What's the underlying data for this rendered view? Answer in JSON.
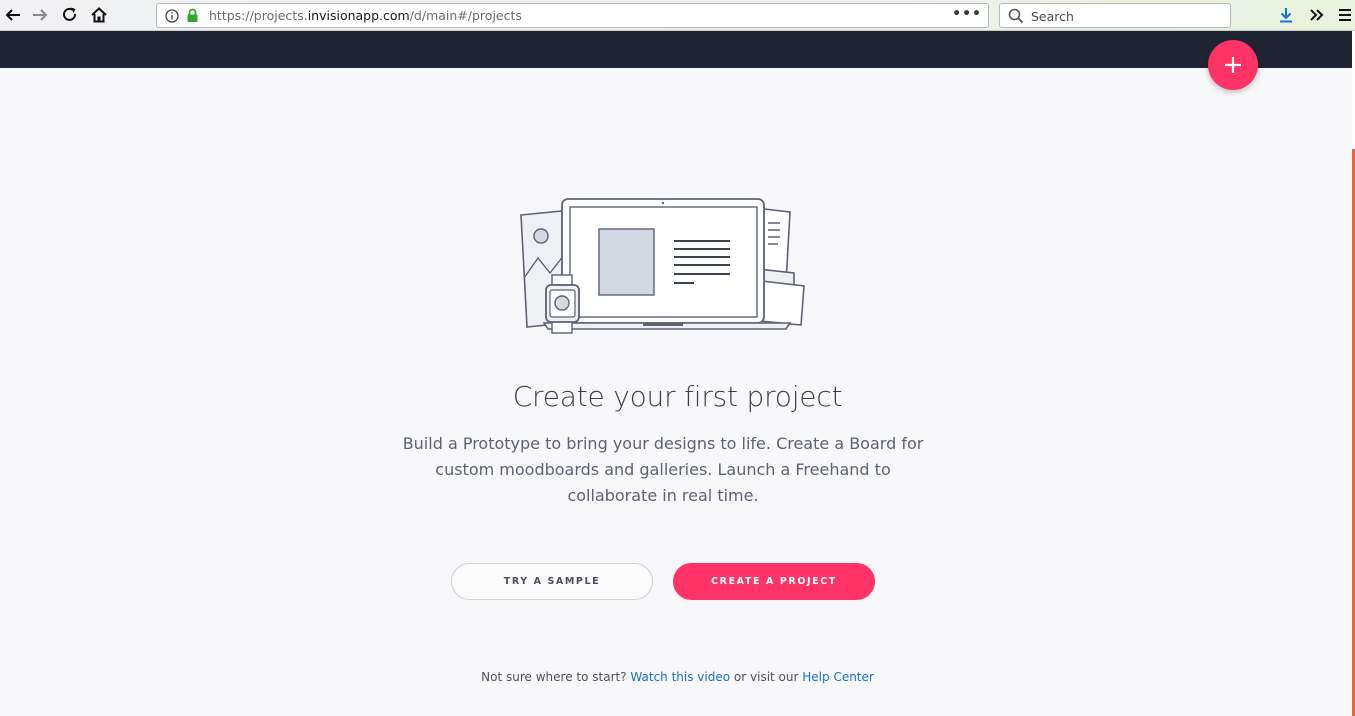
{
  "browser": {
    "url_prefix": "https://projects.",
    "url_host": "invisionapp.com",
    "url_path": "/d/main#/projects",
    "more_label": "•••",
    "search_placeholder": "Search"
  },
  "fab": {
    "icon": "plus-icon"
  },
  "empty_state": {
    "heading": "Create your first project",
    "description": "Build a Prototype to bring your designs to life. Create a Board for custom moodboards and galleries. Launch a Freehand to collaborate in real time.",
    "try_sample_label": "TRY A SAMPLE",
    "create_project_label": "CREATE A PROJECT"
  },
  "help": {
    "prefix": "Not sure where to start?",
    "video_link": "Watch this video",
    "middle": "or visit our",
    "help_link": "Help Center"
  },
  "colors": {
    "accent": "#ff3366",
    "header_bg": "#1f2532",
    "link": "#1a6fd0",
    "page_bg": "#f8f8fa"
  }
}
